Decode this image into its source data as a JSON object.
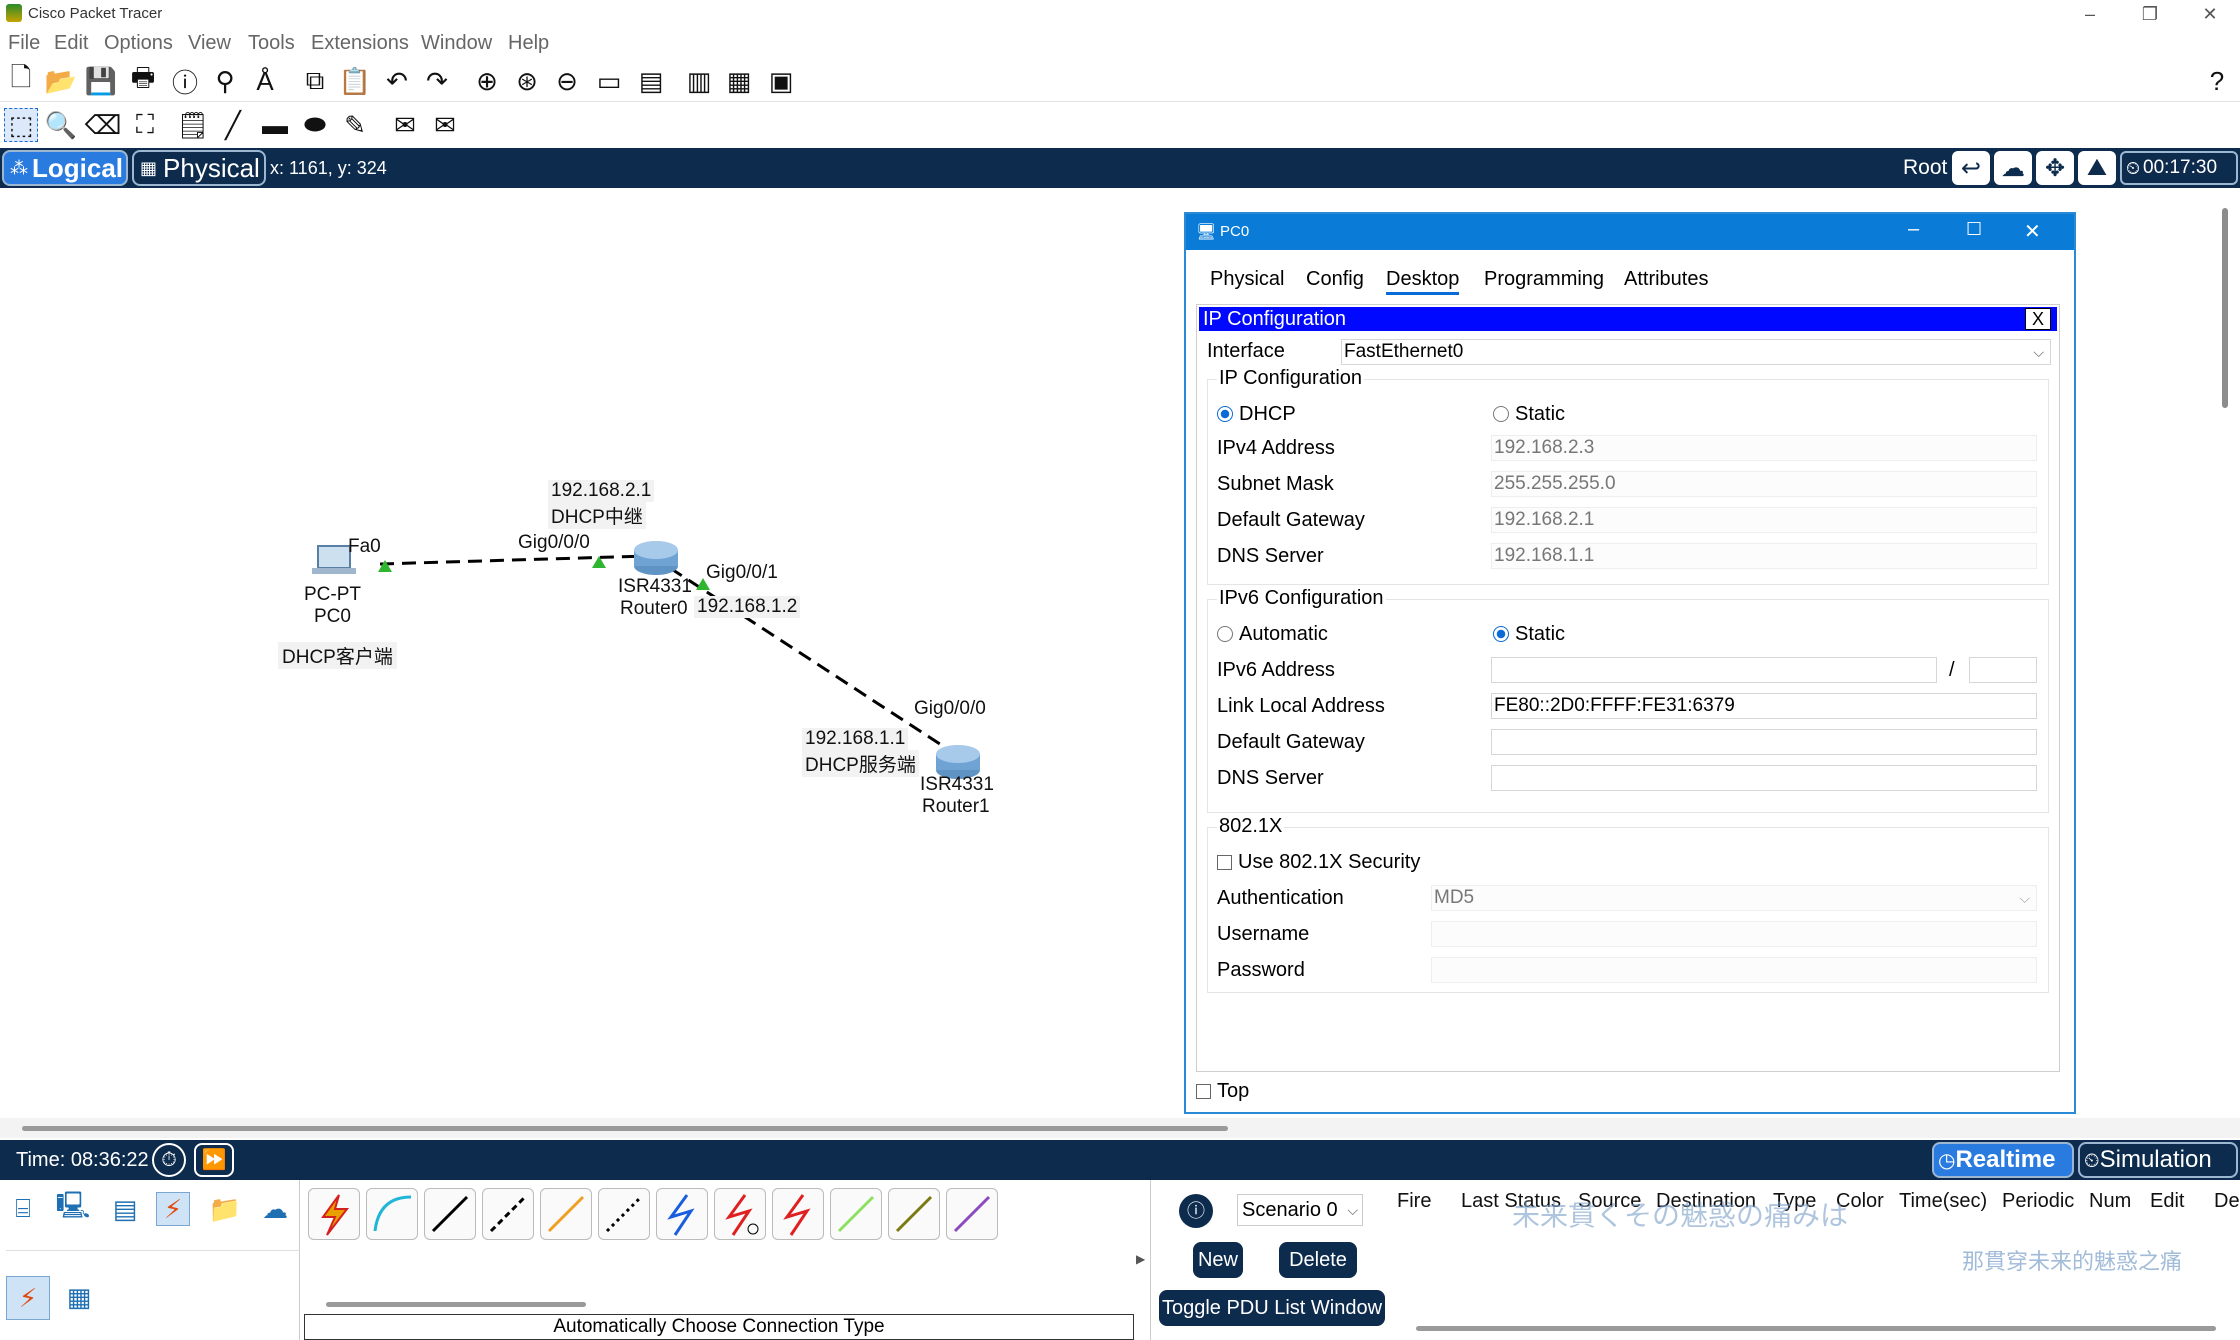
{
  "app": {
    "title": "Cisco Packet Tracer"
  },
  "menu": [
    "File",
    "Edit",
    "Options",
    "View",
    "Tools",
    "Extensions",
    "Window",
    "Help"
  ],
  "logical_bar": {
    "logical_label": "Logical",
    "physical_label": "Physical",
    "coords": "x: 1161, y: 324",
    "root_label": "Root",
    "clock": "00:17:30"
  },
  "topology": {
    "pc_iface": "Fa0",
    "pc_type": "PC-PT",
    "pc_name": "PC0",
    "pc_role": "DHCP客户端",
    "r0_ip": "192.168.2.1",
    "r0_role": "DHCP中继",
    "r0_gig0": "Gig0/0/0",
    "r0_model": "ISR4331",
    "r0_name": "Router0",
    "r0_gig1": "Gig0/0/1",
    "r0_gig1_ip": "192.168.1.2",
    "r1_gig0": "Gig0/0/0",
    "r1_ip": "192.168.1.1",
    "r1_role": "DHCP服务端",
    "r1_model": "ISR4331",
    "r1_name": "Router1"
  },
  "pc_window": {
    "title": "PC0",
    "tabs": [
      "Physical",
      "Config",
      "Desktop",
      "Programming",
      "Attributes"
    ],
    "active_tab": "Desktop",
    "panel_title": "IP Configuration",
    "close_x": "X",
    "interface_label": "Interface",
    "interface_value": "FastEthernet0",
    "ipv4": {
      "section": "IP Configuration",
      "dhcp_label": "DHCP",
      "static_label": "Static",
      "mode": "DHCP",
      "ipv4_label": "IPv4 Address",
      "ipv4_value": "192.168.2.3",
      "mask_label": "Subnet Mask",
      "mask_value": "255.255.255.0",
      "gw_label": "Default Gateway",
      "gw_value": "192.168.2.1",
      "dns_label": "DNS Server",
      "dns_value": "192.168.1.1"
    },
    "ipv6": {
      "section": "IPv6 Configuration",
      "auto_label": "Automatic",
      "static_label": "Static",
      "mode": "Static",
      "addr_label": "IPv6 Address",
      "addr_value": "",
      "slash": "/",
      "prefix_value": "",
      "link_label": "Link Local Address",
      "link_value": "FE80::2D0:FFFF:FE31:6379",
      "gw_label": "Default Gateway",
      "gw_value": "",
      "dns_label": "DNS Server",
      "dns_value": ""
    },
    "dot1x": {
      "section": "802.1X",
      "use_label": "Use 802.1X Security",
      "use_checked": false,
      "auth_label": "Authentication",
      "auth_value": "MD5",
      "user_label": "Username",
      "pass_label": "Password"
    },
    "top_label": "Top"
  },
  "timebar": {
    "time": "Time: 08:36:22",
    "realtime": "Realtime",
    "simulation": "Simulation"
  },
  "bottom": {
    "connection_caption": "Automatically Choose Connection Type",
    "scenario": "Scenario 0",
    "new_label": "New",
    "delete_label": "Delete",
    "toggle_label": "Toggle PDU List Window",
    "pdu_columns": [
      "Fire",
      "Last Status",
      "Source",
      "Destination",
      "Type",
      "Color",
      "Time(sec)",
      "Periodic",
      "Num",
      "Edit",
      "De"
    ],
    "watermark1": "未来貫くその魅惑の痛みは",
    "watermark2": "那貫穿未来的魅惑之痛"
  }
}
